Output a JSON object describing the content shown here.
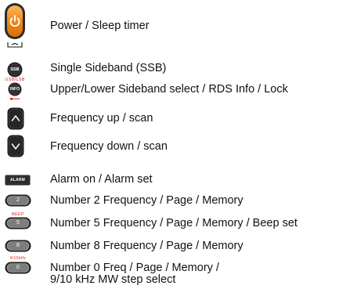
{
  "legend": [
    {
      "label": "Power / Sleep timer"
    },
    {
      "label": "Single Sideband (SSB)"
    },
    {
      "label": "Upper/Lower Sideband select / RDS Info / Lock"
    },
    {
      "label": "Frequency up / scan"
    },
    {
      "label": "Frequency down / scan"
    },
    {
      "label": "Alarm on / Alarm set"
    },
    {
      "label": "Number 2 Frequency / Page / Memory"
    },
    {
      "label": "Number 5 Frequency / Page / Memory / Beep set"
    },
    {
      "label": "Number 8 Frequency / Page / Memory"
    },
    {
      "label": "Number 0 Freq / Page / Memory /",
      "label2": "9/10 kHz MW step select"
    }
  ],
  "buttons": {
    "ssb_text": "SSB",
    "info_text": "INFO",
    "info_top_text": "USB/LSB",
    "alarm_text": "ALARM",
    "num2_text": "2",
    "num5_text": "5",
    "beep_text": "BEEP",
    "num8_text": "8",
    "num0_text": "0",
    "step_text": "9/10kHz"
  },
  "colors": {
    "power_orange": "#f08a1e",
    "button_dark": "#1c1c1c",
    "button_grey": "#7d7d7d",
    "accent_red": "#d9271c"
  }
}
